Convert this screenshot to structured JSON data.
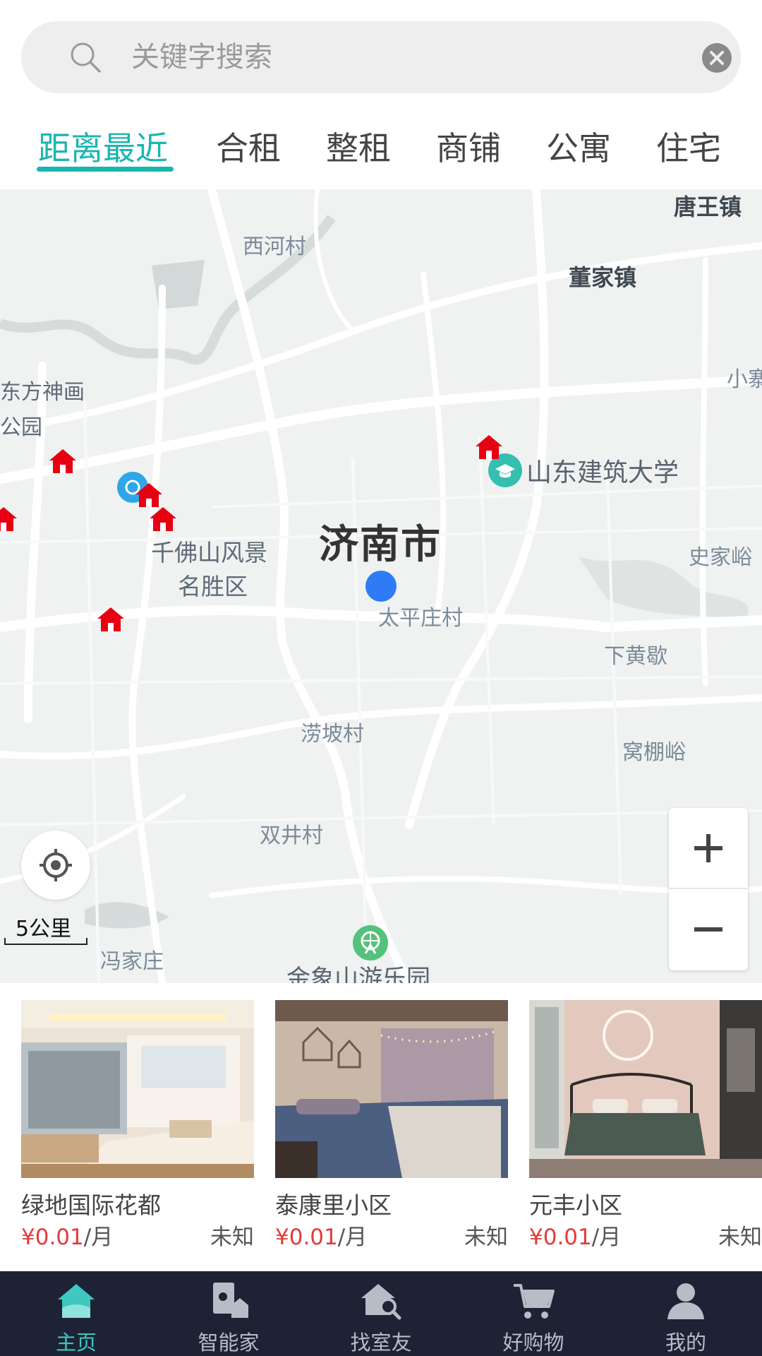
{
  "search": {
    "placeholder": "关键字搜索"
  },
  "tabs": [
    {
      "label": "距离最近",
      "active": true
    },
    {
      "label": "合租"
    },
    {
      "label": "整租"
    },
    {
      "label": "商铺"
    },
    {
      "label": "公寓"
    },
    {
      "label": "住宅"
    }
  ],
  "map": {
    "city_label": "济南市",
    "town_labels": [
      "唐王镇",
      "董家镇"
    ],
    "poi_labels": [
      "山东建筑大学",
      "金象山游乐园"
    ],
    "place_labels": [
      "西河村",
      "东方神画",
      "公园",
      "千佛山风景",
      "名胜区",
      "太平庄村",
      "史家峪",
      "下黄歇",
      "涝坡村",
      "窝棚峪",
      "双井村",
      "冯家庄",
      "小寨"
    ],
    "scale": "5公里",
    "colors": {
      "land": "#eff2f1",
      "road": "#ffffff",
      "marker": "#e60012",
      "user_dot": "#2f7bf6",
      "poi": "#35bfb0"
    }
  },
  "listings": [
    {
      "title": "绿地国际花都",
      "currency": "¥",
      "price": "0.01",
      "unit": "/月",
      "status": "未知"
    },
    {
      "title": "泰康里小区",
      "currency": "¥",
      "price": "0.01",
      "unit": "/月",
      "status": "未知"
    },
    {
      "title": "元丰小区",
      "currency": "¥",
      "price": "0.01",
      "unit": "/月",
      "status": "未知"
    }
  ],
  "nav": [
    {
      "label": "主页",
      "icon": "home-icon",
      "active": true
    },
    {
      "label": "智能家",
      "icon": "smart-home-icon"
    },
    {
      "label": "找室友",
      "icon": "find-roommate-icon"
    },
    {
      "label": "好购物",
      "icon": "cart-icon"
    },
    {
      "label": "我的",
      "icon": "user-icon"
    }
  ],
  "accent_color": "#1bb6b0",
  "price_color": "#e43a3a"
}
